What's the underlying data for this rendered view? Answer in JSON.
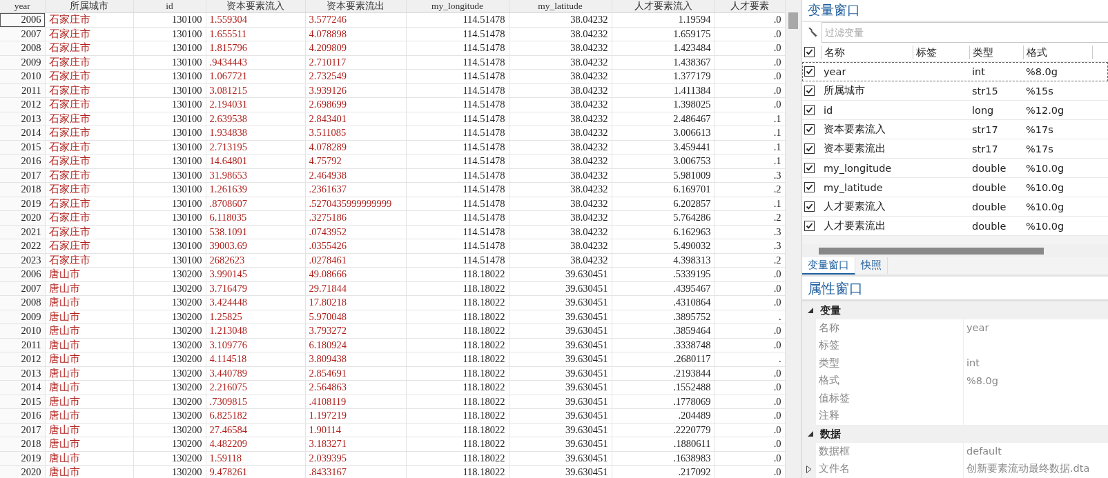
{
  "table": {
    "columns": [
      {
        "label": "year",
        "kind": "numeric"
      },
      {
        "label": "所属城市",
        "kind": "string"
      },
      {
        "label": "id",
        "kind": "numeric"
      },
      {
        "label": "资本要素流入",
        "kind": "string"
      },
      {
        "label": "资本要素流出",
        "kind": "string"
      },
      {
        "label": "my_longitude",
        "kind": "numeric"
      },
      {
        "label": "my_latitude",
        "kind": "numeric"
      },
      {
        "label": "人才要素流入",
        "kind": "numeric"
      },
      {
        "label": "人才要素",
        "kind": "numeric"
      }
    ],
    "rows": [
      {
        "selected": true,
        "cells": [
          "2006",
          "石家庄市",
          "130100",
          "1.559304",
          "3.577246",
          "114.51478",
          "38.04232",
          "1.19594",
          ".0"
        ]
      },
      {
        "selected": false,
        "cells": [
          "2007",
          "石家庄市",
          "130100",
          "1.655511",
          "4.078898",
          "114.51478",
          "38.04232",
          "1.659175",
          ".0"
        ]
      },
      {
        "selected": false,
        "cells": [
          "2008",
          "石家庄市",
          "130100",
          "1.815796",
          "4.209809",
          "114.51478",
          "38.04232",
          "1.423484",
          ".0"
        ]
      },
      {
        "selected": false,
        "cells": [
          "2009",
          "石家庄市",
          "130100",
          ".9434443",
          "2.710117",
          "114.51478",
          "38.04232",
          "1.438367",
          ".0"
        ]
      },
      {
        "selected": false,
        "cells": [
          "2010",
          "石家庄市",
          "130100",
          "1.067721",
          "2.732549",
          "114.51478",
          "38.04232",
          "1.377179",
          ".0"
        ]
      },
      {
        "selected": false,
        "cells": [
          "2011",
          "石家庄市",
          "130100",
          "3.081215",
          "3.939126",
          "114.51478",
          "38.04232",
          "1.411384",
          ".0"
        ]
      },
      {
        "selected": false,
        "cells": [
          "2012",
          "石家庄市",
          "130100",
          "2.194031",
          "2.698699",
          "114.51478",
          "38.04232",
          "1.398025",
          ".0"
        ]
      },
      {
        "selected": false,
        "cells": [
          "2013",
          "石家庄市",
          "130100",
          "2.639538",
          "2.843401",
          "114.51478",
          "38.04232",
          "2.486467",
          ".1"
        ]
      },
      {
        "selected": false,
        "cells": [
          "2014",
          "石家庄市",
          "130100",
          "1.934838",
          "3.511085",
          "114.51478",
          "38.04232",
          "3.006613",
          ".1"
        ]
      },
      {
        "selected": false,
        "cells": [
          "2015",
          "石家庄市",
          "130100",
          "2.713195",
          "4.078289",
          "114.51478",
          "38.04232",
          "3.459441",
          ".1"
        ]
      },
      {
        "selected": false,
        "cells": [
          "2016",
          "石家庄市",
          "130100",
          "14.64801",
          "4.75792",
          "114.51478",
          "38.04232",
          "3.006753",
          ".1"
        ]
      },
      {
        "selected": false,
        "cells": [
          "2017",
          "石家庄市",
          "130100",
          "31.98653",
          "2.464938",
          "114.51478",
          "38.04232",
          "5.981009",
          ".3"
        ]
      },
      {
        "selected": false,
        "cells": [
          "2018",
          "石家庄市",
          "130100",
          "1.261639",
          ".2361637",
          "114.51478",
          "38.04232",
          "6.169701",
          ".2"
        ]
      },
      {
        "selected": false,
        "cells": [
          "2019",
          "石家庄市",
          "130100",
          ".8708607",
          ".5270435999999999",
          "114.51478",
          "38.04232",
          "6.202857",
          ".1"
        ]
      },
      {
        "selected": false,
        "cells": [
          "2020",
          "石家庄市",
          "130100",
          "6.118035",
          ".3275186",
          "114.51478",
          "38.04232",
          "5.764286",
          ".2"
        ]
      },
      {
        "selected": false,
        "cells": [
          "2021",
          "石家庄市",
          "130100",
          "538.1091",
          ".0743952",
          "114.51478",
          "38.04232",
          "6.162963",
          ".3"
        ]
      },
      {
        "selected": false,
        "cells": [
          "2022",
          "石家庄市",
          "130100",
          "39003.69",
          ".0355426",
          "114.51478",
          "38.04232",
          "5.490032",
          ".3"
        ]
      },
      {
        "selected": false,
        "cells": [
          "2023",
          "石家庄市",
          "130100",
          "2682623",
          ".0278461",
          "114.51478",
          "38.04232",
          "4.398313",
          ".2"
        ]
      },
      {
        "selected": false,
        "cells": [
          "2006",
          "唐山市",
          "130200",
          "3.990145",
          "49.08666",
          "118.18022",
          "39.630451",
          ".5339195",
          ".0"
        ]
      },
      {
        "selected": false,
        "cells": [
          "2007",
          "唐山市",
          "130200",
          "3.716479",
          "29.71844",
          "118.18022",
          "39.630451",
          ".4395467",
          ".0"
        ]
      },
      {
        "selected": false,
        "cells": [
          "2008",
          "唐山市",
          "130200",
          "3.424448",
          "17.80218",
          "118.18022",
          "39.630451",
          ".4310864",
          ".0"
        ]
      },
      {
        "selected": false,
        "cells": [
          "2009",
          "唐山市",
          "130200",
          "1.25825",
          "5.970048",
          "118.18022",
          "39.630451",
          ".3895752",
          "."
        ]
      },
      {
        "selected": false,
        "cells": [
          "2010",
          "唐山市",
          "130200",
          "1.213048",
          "3.793272",
          "118.18022",
          "39.630451",
          ".3859464",
          ".0"
        ]
      },
      {
        "selected": false,
        "cells": [
          "2011",
          "唐山市",
          "130200",
          "3.109776",
          "6.180924",
          "118.18022",
          "39.630451",
          ".3338748",
          ".0"
        ]
      },
      {
        "selected": false,
        "cells": [
          "2012",
          "唐山市",
          "130200",
          "4.114518",
          "3.809438",
          "118.18022",
          "39.630451",
          ".2680117",
          "."
        ]
      },
      {
        "selected": false,
        "cells": [
          "2013",
          "唐山市",
          "130200",
          "3.440789",
          "2.854691",
          "118.18022",
          "39.630451",
          ".2193844",
          ".0"
        ]
      },
      {
        "selected": false,
        "cells": [
          "2014",
          "唐山市",
          "130200",
          "2.216075",
          "2.564863",
          "118.18022",
          "39.630451",
          ".1552488",
          ".0"
        ]
      },
      {
        "selected": false,
        "cells": [
          "2015",
          "唐山市",
          "130200",
          ".7309815",
          ".4108119",
          "118.18022",
          "39.630451",
          ".1778069",
          ".0"
        ]
      },
      {
        "selected": false,
        "cells": [
          "2016",
          "唐山市",
          "130200",
          "6.825182",
          "1.197219",
          "118.18022",
          "39.630451",
          ".204489",
          ".0"
        ]
      },
      {
        "selected": false,
        "cells": [
          "2017",
          "唐山市",
          "130200",
          "27.46584",
          "1.90114",
          "118.18022",
          "39.630451",
          ".2220779",
          ".0"
        ]
      },
      {
        "selected": false,
        "cells": [
          "2018",
          "唐山市",
          "130200",
          "4.482209",
          "3.183271",
          "118.18022",
          "39.630451",
          ".1880611",
          ".0"
        ]
      },
      {
        "selected": false,
        "cells": [
          "2019",
          "唐山市",
          "130200",
          "1.59118",
          "2.039395",
          "118.18022",
          "39.630451",
          ".1638983",
          ".0"
        ]
      },
      {
        "selected": false,
        "cells": [
          "2020",
          "唐山市",
          "130200",
          "9.478261",
          ".8433167",
          "118.18022",
          "39.630451",
          ".217092",
          ".0"
        ]
      }
    ]
  },
  "variables_window": {
    "title": "变量窗口",
    "filter": {
      "placeholder": "过滤变量"
    },
    "select_all_checked": true,
    "columns": [
      "名称",
      "标签",
      "类型",
      "格式"
    ],
    "variables": [
      {
        "name": "year",
        "type": "int",
        "format": "%8.0g",
        "checked": true,
        "selected": true
      },
      {
        "name": "所属城市",
        "type": "str15",
        "format": "%15s",
        "checked": true,
        "selected": false
      },
      {
        "name": "id",
        "type": "long",
        "format": "%12.0g",
        "checked": true,
        "selected": false
      },
      {
        "name": "资本要素流入",
        "type": "str17",
        "format": "%17s",
        "checked": true,
        "selected": false
      },
      {
        "name": "资本要素流出",
        "type": "str17",
        "format": "%17s",
        "checked": true,
        "selected": false
      },
      {
        "name": "my_longitude",
        "type": "double",
        "format": "%10.0g",
        "checked": true,
        "selected": false
      },
      {
        "name": "my_latitude",
        "type": "double",
        "format": "%10.0g",
        "checked": true,
        "selected": false
      },
      {
        "name": "人才要素流入",
        "type": "double",
        "format": "%10.0g",
        "checked": true,
        "selected": false
      },
      {
        "name": "人才要素流出",
        "type": "double",
        "format": "%10.0g",
        "checked": true,
        "selected": false
      }
    ]
  },
  "tabs": [
    {
      "label": "变量窗口",
      "selected": true
    },
    {
      "label": "快照",
      "selected": false
    }
  ],
  "properties_window": {
    "title": "属性窗口",
    "sections": [
      {
        "title": "变量",
        "expanded": true,
        "rows": [
          {
            "key": "名称",
            "value": "year"
          },
          {
            "key": "标签"
          },
          {
            "key": "类型",
            "value": "int"
          },
          {
            "key": "格式",
            "value": "%8.0g"
          },
          {
            "key": "值标签"
          },
          {
            "key": "注释"
          }
        ]
      },
      {
        "title": "数据",
        "expanded": true,
        "rows": [
          {
            "key": "数据框",
            "value": "default"
          },
          {
            "key": "文件名",
            "value": "创新要素流动最终数据.dta",
            "expanded": false
          }
        ]
      }
    ]
  }
}
